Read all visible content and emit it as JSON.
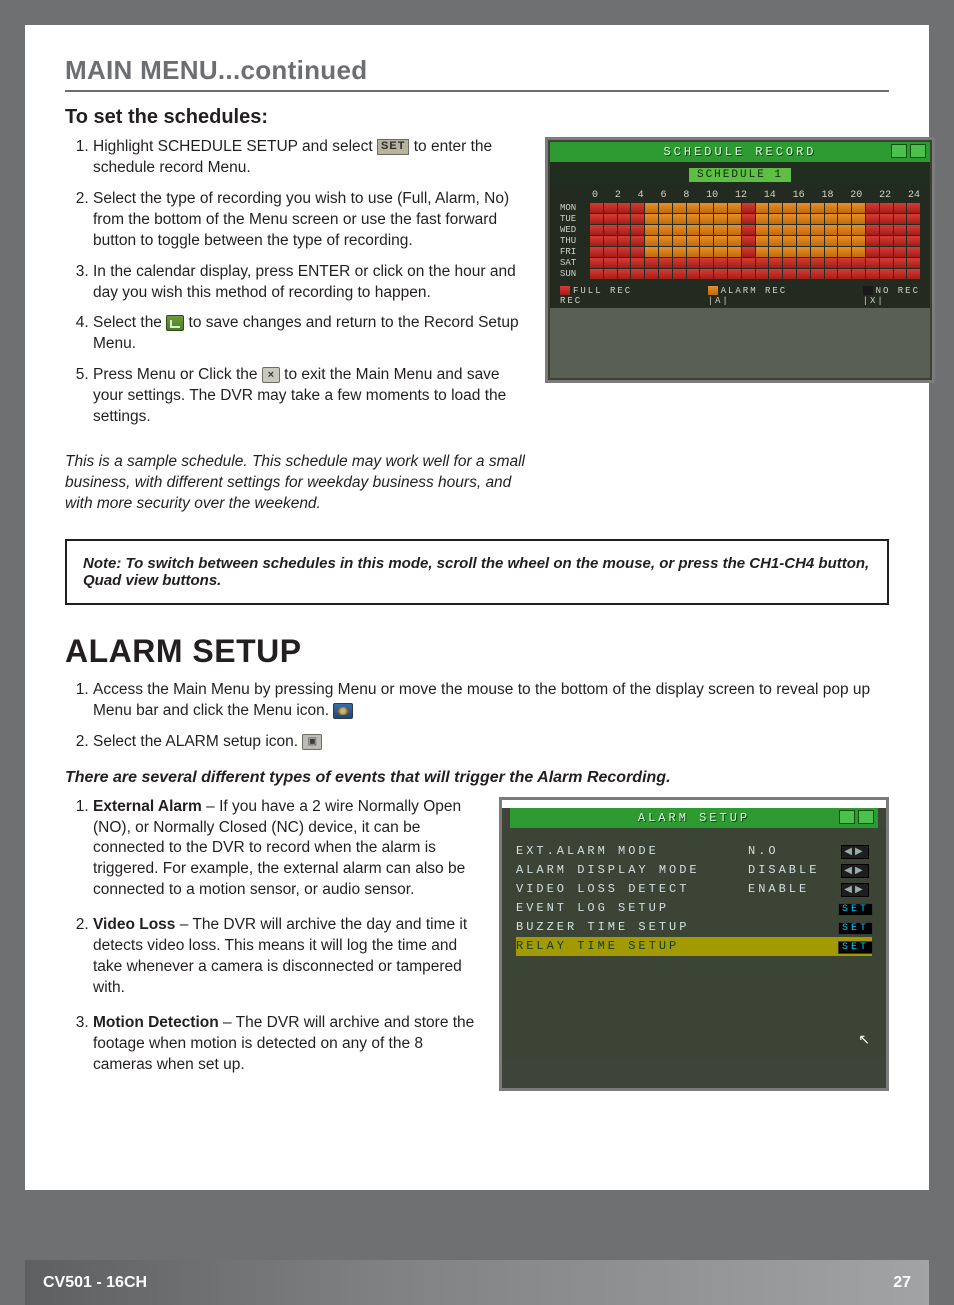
{
  "header": {
    "section_title": "MAIN MENU...continued"
  },
  "schedules": {
    "title": "To set the schedules:",
    "items": [
      {
        "pre": "Highlight SCHEDULE SETUP and select ",
        "badge": "SET",
        "post": " to enter the schedule record Menu."
      },
      {
        "text": "Select the type of recording you wish to use (Full, Alarm, No) from the bottom of the Menu screen or use the fast forward button to toggle between the type of recording."
      },
      {
        "text": "In the calendar display, press ENTER or click on the hour and day you wish this method of recording to happen."
      },
      {
        "pre": "Select the ",
        "post": " to save changes and return to the Record Setup Menu."
      },
      {
        "pre": "Press Menu or Click the ",
        "post": " to exit the Main Menu and save your settings. The DVR may take a few moments to load the settings."
      }
    ],
    "italic": "This is a sample schedule. This schedule may work well for a small business, with different settings for weekday business hours, and with more security over the weekend."
  },
  "schedule_screen": {
    "title": "SCHEDULE RECORD",
    "subtitle": "SCHEDULE 1",
    "hours": [
      "0",
      "2",
      "4",
      "6",
      "8",
      "10",
      "12",
      "14",
      "16",
      "18",
      "20",
      "22",
      "24"
    ],
    "days": [
      "MON",
      "TUE",
      "WED",
      "THU",
      "FRI",
      "SAT",
      "SUN"
    ],
    "legend": {
      "full": "FULL REC",
      "full2": "REC",
      "alarm": "ALARM REC",
      "alarm2": "|A|",
      "no": "NO REC",
      "no2": "|X|"
    }
  },
  "note_box": "Note: To switch between schedules in this mode, scroll the wheel on the mouse, or press the CH1-CH4 button, Quad view buttons.",
  "alarm": {
    "title": "ALARM SETUP",
    "steps": [
      {
        "pre": "Access the Main Menu by pressing Menu or move the mouse to the bottom of the display screen to reveal pop up Menu bar and click the Menu icon. "
      },
      {
        "pre": "Select the ALARM setup icon. "
      }
    ],
    "em": "There are several different types of events that will trigger the Alarm Recording.",
    "events": [
      {
        "label": "External Alarm",
        "text": " – If you have a 2 wire Normally Open (NO), or Normally Closed (NC) device, it can be connected to the DVR to record when the alarm is triggered. For example, the external alarm can also be connected to a motion sensor, or audio sensor."
      },
      {
        "label": "Video Loss",
        "text": " – The DVR will archive the day and time it detects video loss. This means it will log the time and take whenever a camera is disconnected or tampered with."
      },
      {
        "label": "Motion Detection",
        "text": " – The DVR will archive and store the footage when motion is detected on any of the 8 cameras when set up."
      }
    ]
  },
  "alarm_screen": {
    "title": "ALARM SETUP",
    "rows": [
      {
        "label": "EXT.ALARM MODE",
        "val": "N.O",
        "ctl": "arrows"
      },
      {
        "label": "ALARM DISPLAY MODE",
        "val": "DISABLE",
        "ctl": "arrows"
      },
      {
        "label": "VIDEO LOSS DETECT",
        "val": "ENABLE",
        "ctl": "arrows"
      },
      {
        "label": "EVENT LOG SETUP",
        "val": "",
        "ctl": "set"
      },
      {
        "label": "BUZZER TIME SETUP",
        "val": "",
        "ctl": "set"
      },
      {
        "label": "RELAY TIME SETUP",
        "val": "",
        "ctl": "set",
        "hl": true
      }
    ]
  },
  "footer": {
    "model": "CV501 - 16CH",
    "page": "27"
  }
}
